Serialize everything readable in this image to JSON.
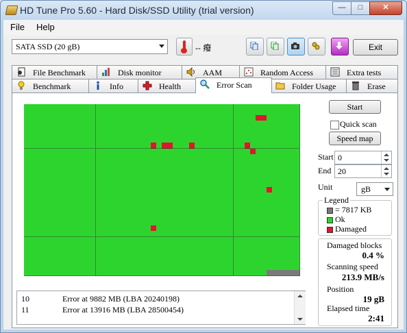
{
  "window": {
    "title": "HD Tune Pro 5.60 - Hard Disk/SSD Utility (trial version)",
    "minimize": "—",
    "maximize": "□",
    "close": "✕"
  },
  "menu": {
    "file": "File",
    "help": "Help"
  },
  "toolbar": {
    "drive": "SATA SSD (20 gB)",
    "temperature": "-- 癈",
    "exit": "Exit",
    "icons": [
      "thermometer-icon",
      "copy-info-icon",
      "copy-text-icon",
      "camera-icon",
      "options-icon",
      "save-icon"
    ]
  },
  "tabs_top": [
    "File Benchmark",
    "Disk monitor",
    "AAM",
    "Random Access",
    "Extra tests"
  ],
  "tabs_bottom": [
    "Benchmark",
    "Info",
    "Health",
    "Error Scan",
    "Folder Usage",
    "Erase"
  ],
  "scan": {
    "start_btn": "Start",
    "quick_scan": "Quick scan",
    "speed_map": "Speed map",
    "start_label": "Start",
    "start_value": "0",
    "end_label": "End",
    "end_value": "20",
    "unit_label": "Unit",
    "unit_value": "gB"
  },
  "legend": {
    "title": "Legend",
    "block_size": "= 7817 KB",
    "ok": "Ok",
    "damaged": "Damaged",
    "colors": {
      "ok": "#2ed42e",
      "damaged": "#e0162f",
      "block": "#7a7a7a"
    }
  },
  "stats": {
    "damaged_blocks_label": "Damaged blocks",
    "damaged_blocks_value": "0.4 %",
    "scanning_speed_label": "Scanning speed",
    "scanning_speed_value": "213.9 MB/s",
    "position_label": "Position",
    "position_value": "19 gB",
    "elapsed_label": "Elapsed time",
    "elapsed_value": "2:41"
  },
  "log": [
    {
      "n": "10",
      "text": "Error at 9882 MB (LBA 20240198)"
    },
    {
      "n": "11",
      "text": "Error at 13916 MB (LBA 28500454)"
    }
  ],
  "block_map": {
    "columns": 50,
    "rows": 31,
    "damaged_cells": [
      [
        2,
        42
      ],
      [
        2,
        43
      ],
      [
        7,
        23
      ],
      [
        7,
        25
      ],
      [
        7,
        26
      ],
      [
        7,
        30
      ],
      [
        7,
        40
      ],
      [
        8,
        41
      ],
      [
        15,
        44
      ],
      [
        22,
        23
      ]
    ],
    "pending_from": [
      30,
      44
    ]
  }
}
